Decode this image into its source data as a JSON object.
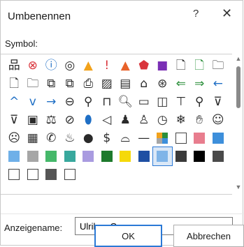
{
  "dialog": {
    "title": "Umbenennen",
    "help_label": "?",
    "close_label": "✕"
  },
  "symbol_label": "Symbol:",
  "symbols": [
    {
      "name": "org-chart-icon",
      "glyph": "品",
      "color": "#2a2a2a"
    },
    {
      "name": "error-circle-icon",
      "glyph": "⊗",
      "color": "#d9343b"
    },
    {
      "name": "info-circle-icon",
      "glyph": "ⓘ",
      "color": "#1f6fc5"
    },
    {
      "name": "target-icon",
      "glyph": "◎",
      "color": "#2a2a2a"
    },
    {
      "name": "warning-triangle-icon",
      "glyph": "▲",
      "color": "#f2a21b"
    },
    {
      "name": "exclamation-icon",
      "glyph": "!",
      "color": "#d9343b"
    },
    {
      "name": "warning-red-icon",
      "glyph": "▲",
      "color": "#e8622a"
    },
    {
      "name": "shield-icon",
      "glyph": "⬟",
      "color": "#d9343b"
    },
    {
      "name": "save-disk-icon",
      "glyph": "■",
      "color": "#7a2fb5"
    },
    {
      "name": "document-icon",
      "glyph": "🗋",
      "color": "#2a2a2a"
    },
    {
      "name": "document-green-icon",
      "glyph": "🗋",
      "color": "#2b8f3b"
    },
    {
      "name": "folder-icon",
      "glyph": "🗀",
      "color": "#2a2a2a"
    },
    {
      "name": "page-icon",
      "glyph": "🗋",
      "color": "#2a2a2a"
    },
    {
      "name": "folder2-icon",
      "glyph": "🗀",
      "color": "#2a2a2a"
    },
    {
      "name": "window-copy-icon",
      "glyph": "⧉",
      "color": "#2a2a2a"
    },
    {
      "name": "window-copy2-icon",
      "glyph": "⧉",
      "color": "#2a2a2a"
    },
    {
      "name": "print-icon",
      "glyph": "⎙",
      "color": "#2a2a2a"
    },
    {
      "name": "image-icon",
      "glyph": "▨",
      "color": "#2a2a2a"
    },
    {
      "name": "ebook-icon",
      "glyph": "▤",
      "color": "#2a2a2a"
    },
    {
      "name": "home-icon",
      "glyph": "⌂",
      "color": "#2a2a2a"
    },
    {
      "name": "world-icon",
      "glyph": "⊛",
      "color": "#2a2a2a"
    },
    {
      "name": "arrow-left-green-icon",
      "glyph": "⇐",
      "color": "#2b8f3b"
    },
    {
      "name": "arrow-right-green-icon",
      "glyph": "⇒",
      "color": "#2b8f3b"
    },
    {
      "name": "arrow-left-icon",
      "glyph": "←",
      "color": "#1f6fc5"
    },
    {
      "name": "chevron-up-icon",
      "glyph": "^",
      "color": "#1f6fc5"
    },
    {
      "name": "chevron-down-icon",
      "glyph": "v",
      "color": "#1f6fc5"
    },
    {
      "name": "arrow-right-icon",
      "glyph": "→",
      "color": "#1f6fc5"
    },
    {
      "name": "back-circle-icon",
      "glyph": "⊖",
      "color": "#2a2a2a"
    },
    {
      "name": "pin-icon",
      "glyph": "⚲",
      "color": "#2a2a2a"
    },
    {
      "name": "lock-icon",
      "glyph": "⊓",
      "color": "#2a2a2a"
    },
    {
      "name": "zoom-icon",
      "glyph": "🔍︎",
      "color": "#2a2a2a"
    },
    {
      "name": "clipboard-icon",
      "glyph": "▭",
      "color": "#2a2a2a"
    },
    {
      "name": "bookmark-icon",
      "glyph": "◫",
      "color": "#2a2a2a"
    },
    {
      "name": "screen-icon",
      "glyph": "⊤",
      "color": "#2a2a2a"
    },
    {
      "name": "search-icon",
      "glyph": "⚲",
      "color": "#2a2a2a"
    },
    {
      "name": "filter-icon",
      "glyph": "⊽",
      "color": "#2a2a2a"
    },
    {
      "name": "filter2-icon",
      "glyph": "⊽",
      "color": "#2a2a2a"
    },
    {
      "name": "contact-card-icon",
      "glyph": "▣",
      "color": "#2a2a2a"
    },
    {
      "name": "scales-icon",
      "glyph": "⚖",
      "color": "#2a2a2a"
    },
    {
      "name": "no-entry-icon",
      "glyph": "⊘",
      "color": "#2a2a2a"
    },
    {
      "name": "microphone-icon",
      "glyph": "⬮",
      "color": "#1f6fc5"
    },
    {
      "name": "mute-icon",
      "glyph": "◁",
      "color": "#2a2a2a"
    },
    {
      "name": "users-icon",
      "glyph": "♟",
      "color": "#2a2a2a"
    },
    {
      "name": "user-icon",
      "glyph": "♙",
      "color": "#2a2a2a"
    },
    {
      "name": "clock-icon",
      "glyph": "◷",
      "color": "#2a2a2a"
    },
    {
      "name": "snowflake-icon",
      "glyph": "❄",
      "color": "#2a2a2a"
    },
    {
      "name": "hand-icon",
      "glyph": "✋︎",
      "color": "#2a2a2a"
    },
    {
      "name": "smiley-icon",
      "glyph": "☺",
      "color": "#2a2a2a"
    },
    {
      "name": "sad-face-icon",
      "glyph": "☹",
      "color": "#2a2a2a"
    },
    {
      "name": "calculator-icon",
      "glyph": "▦",
      "color": "#2a2a2a"
    },
    {
      "name": "phone-icon",
      "glyph": "✆",
      "color": "#2a2a2a"
    },
    {
      "name": "piggy-bank-icon",
      "glyph": "♨",
      "color": "#2a2a2a"
    },
    {
      "name": "badge-icon",
      "glyph": "●",
      "color": "#2a2a2a"
    },
    {
      "name": "dollar-icon",
      "glyph": "$",
      "color": "#2a2a2a"
    },
    {
      "name": "wifi-icon",
      "glyph": "⌓",
      "color": "#2a2a2a"
    },
    {
      "name": "minus-icon",
      "glyph": "—",
      "color": "#2a2a2a"
    },
    {
      "name": "grid-colors-icon",
      "swatch": "grid"
    },
    {
      "name": "swatch-white-icon",
      "swatch": "#ffffff",
      "border": true
    },
    {
      "name": "swatch-pink-icon",
      "swatch": "#e87d8e"
    },
    {
      "name": "swatch-blue-icon",
      "swatch": "#3d8fdb"
    },
    {
      "name": "swatch-lightblue-icon",
      "swatch": "#6fb0e8"
    },
    {
      "name": "swatch-gray-icon",
      "swatch": "#a6a6a6"
    },
    {
      "name": "swatch-green-icon",
      "swatch": "#45b86a"
    },
    {
      "name": "swatch-teal-icon",
      "swatch": "#38a89d"
    },
    {
      "name": "swatch-lavender-icon",
      "swatch": "#a99be0"
    },
    {
      "name": "swatch-darkgreen-icon",
      "swatch": "#1d7a2c"
    },
    {
      "name": "swatch-yellow-icon",
      "swatch": "#f5d90a"
    },
    {
      "name": "swatch-navy-icon",
      "swatch": "#1f4fa3"
    },
    {
      "name": "swatch-pattern-icon",
      "swatch": "#7fb4e8",
      "selected": true
    },
    {
      "name": "swatch-split-icon",
      "swatch": "#3a3a3a"
    },
    {
      "name": "swatch-black-icon",
      "swatch": "#000000"
    },
    {
      "name": "swatch-gray-half-icon",
      "swatch": "#4a4a4a"
    },
    {
      "name": "swatch-outline-icon",
      "swatch": "#ffffff",
      "border": true
    },
    {
      "name": "swatch-diagonal-icon",
      "swatch": "#ffffff",
      "border": true
    },
    {
      "name": "swatch-gradient-icon",
      "swatch": "#555555"
    },
    {
      "name": "swatch-empty-icon",
      "swatch": "#ffffff",
      "border": true
    }
  ],
  "name_field": {
    "label": "Anzeigename:",
    "value": "Ulrikes Gruppe"
  },
  "buttons": {
    "ok": "OK",
    "cancel": "Abbrechen"
  },
  "scrollbar": {
    "up": "▲",
    "down": "▼"
  }
}
